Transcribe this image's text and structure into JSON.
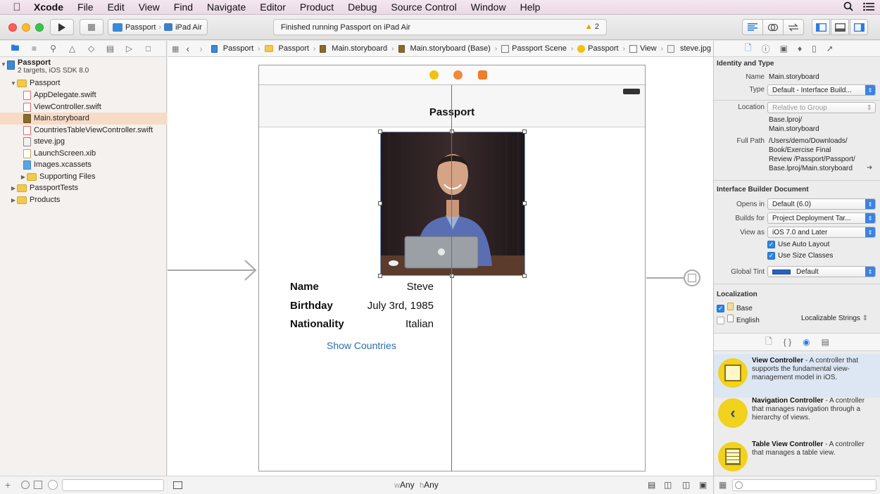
{
  "menubar": {
    "items": [
      "Xcode",
      "File",
      "Edit",
      "View",
      "Find",
      "Navigate",
      "Editor",
      "Product",
      "Debug",
      "Source Control",
      "Window",
      "Help"
    ]
  },
  "toolbar": {
    "scheme_target": "Passport",
    "scheme_device": "iPad Air",
    "status_text": "Finished running Passport on iPad Air",
    "warning_count": "2"
  },
  "navigator": {
    "project_name": "Passport",
    "project_sub": "2 targets, iOS SDK 8.0",
    "items": [
      {
        "label": "Passport"
      },
      {
        "label": "AppDelegate.swift"
      },
      {
        "label": "ViewController.swift"
      },
      {
        "label": "Main.storyboard"
      },
      {
        "label": "CountriesTableViewController.swift"
      },
      {
        "label": "steve.jpg"
      },
      {
        "label": "LaunchScreen.xib"
      },
      {
        "label": "Images.xcassets"
      },
      {
        "label": "Supporting Files"
      },
      {
        "label": "PassportTests"
      },
      {
        "label": "Products"
      }
    ]
  },
  "jumpbar": {
    "crumbs": [
      "Passport",
      "Passport",
      "Main.storyboard",
      "Main.storyboard (Base)",
      "Passport Scene",
      "Passport",
      "View",
      "steve.jpg"
    ]
  },
  "scene": {
    "nav_title": "Passport",
    "rows": [
      {
        "label": "Name",
        "value": "Steve"
      },
      {
        "label": "Birthday",
        "value": "July 3rd, 1985"
      },
      {
        "label": "Nationality",
        "value": "Italian"
      }
    ],
    "button": "Show Countries"
  },
  "editor_bottom": {
    "w_prefix": "w",
    "w_value": "Any",
    "h_prefix": "h",
    "h_value": "Any"
  },
  "inspector": {
    "identity_header": "Identity and Type",
    "name_label": "Name",
    "name_value": "Main.storyboard",
    "type_label": "Type",
    "type_value": "Default - Interface Build...",
    "location_label": "Location",
    "location_value": "Relative to Group",
    "rel_path_1": "Base.lproj/",
    "rel_path_2": "Main.storyboard",
    "fullpath_label": "Full Path",
    "fullpath_1": "/Users/demo/Downloads/",
    "fullpath_2": "Book/Exercise Final",
    "fullpath_3": "Review /Passport/Passport/",
    "fullpath_4": "Base.lproj/Main.storyboard",
    "ibdoc_header": "Interface Builder Document",
    "opens_label": "Opens in",
    "opens_value": "Default (6.0)",
    "builds_label": "Builds for",
    "builds_value": "Project Deployment Tar...",
    "viewas_label": "View as",
    "viewas_value": "iOS 7.0 and Later",
    "autolayout": "Use Auto Layout",
    "sizeclasses": "Use Size Classes",
    "tint_label": "Global Tint",
    "tint_value": "Default",
    "loc_header": "Localization",
    "loc_base": "Base",
    "loc_english": "English",
    "loc_english_type": "Localizable Strings",
    "library": [
      {
        "title": "View Controller",
        "desc": " - A controller that supports the fundamental view-management model in iOS."
      },
      {
        "title": "Navigation Controller",
        "desc": " - A controller that manages navigation through a hierarchy of views."
      },
      {
        "title": "Table View Controller",
        "desc": " - A controller that manages a table view."
      }
    ]
  },
  "colors": {
    "accent": "#2a84e4",
    "selection": "#f7dbc6",
    "guide": "#4a78a8",
    "link": "#2a6fb3"
  }
}
